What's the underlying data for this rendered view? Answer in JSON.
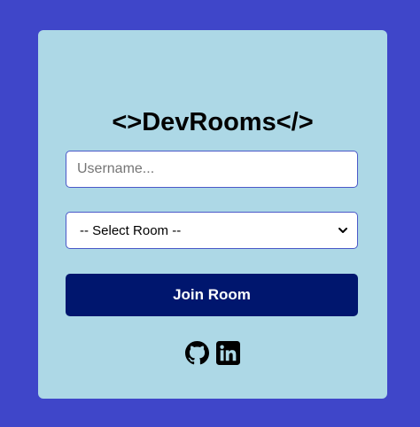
{
  "app": {
    "title": "<>DevRooms</>"
  },
  "form": {
    "username_placeholder": "Username...",
    "username_value": "",
    "room_selected": "-- Select Room --",
    "join_label": "Join Room"
  },
  "socials": [
    {
      "icon": "github-icon"
    },
    {
      "icon": "linkedin-icon"
    }
  ],
  "colors": {
    "background": "#3f46c9",
    "card": "#add8e6",
    "button": "#00166e",
    "input_border": "#4a58c8"
  }
}
